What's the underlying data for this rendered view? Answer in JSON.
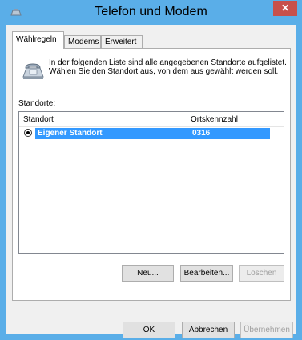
{
  "window": {
    "title": "Telefon und Modem",
    "close_label": "✕"
  },
  "tabs": [
    {
      "label": "Wählregeln",
      "active": true
    },
    {
      "label": "Modems",
      "active": false
    },
    {
      "label": "Erweitert",
      "active": false
    }
  ],
  "panel": {
    "description": "In der folgenden Liste sind alle angegebenen Standorte aufgelistet. Wählen Sie den Standort aus, von dem aus gewählt werden soll.",
    "locations_label": "Standorte:",
    "columns": [
      "Standort",
      "Ortskennzahl"
    ],
    "rows": [
      {
        "location": "Eigener Standort",
        "area_code": "0316",
        "selected": true
      }
    ],
    "buttons": {
      "new": "Neu...",
      "edit": "Bearbeiten...",
      "delete": "Löschen"
    }
  },
  "footer": {
    "ok": "OK",
    "cancel": "Abbrechen",
    "apply": "Übernehmen"
  },
  "colors": {
    "titlebar": "#5aaee8",
    "close": "#c7504b",
    "selection": "#3399ff"
  }
}
